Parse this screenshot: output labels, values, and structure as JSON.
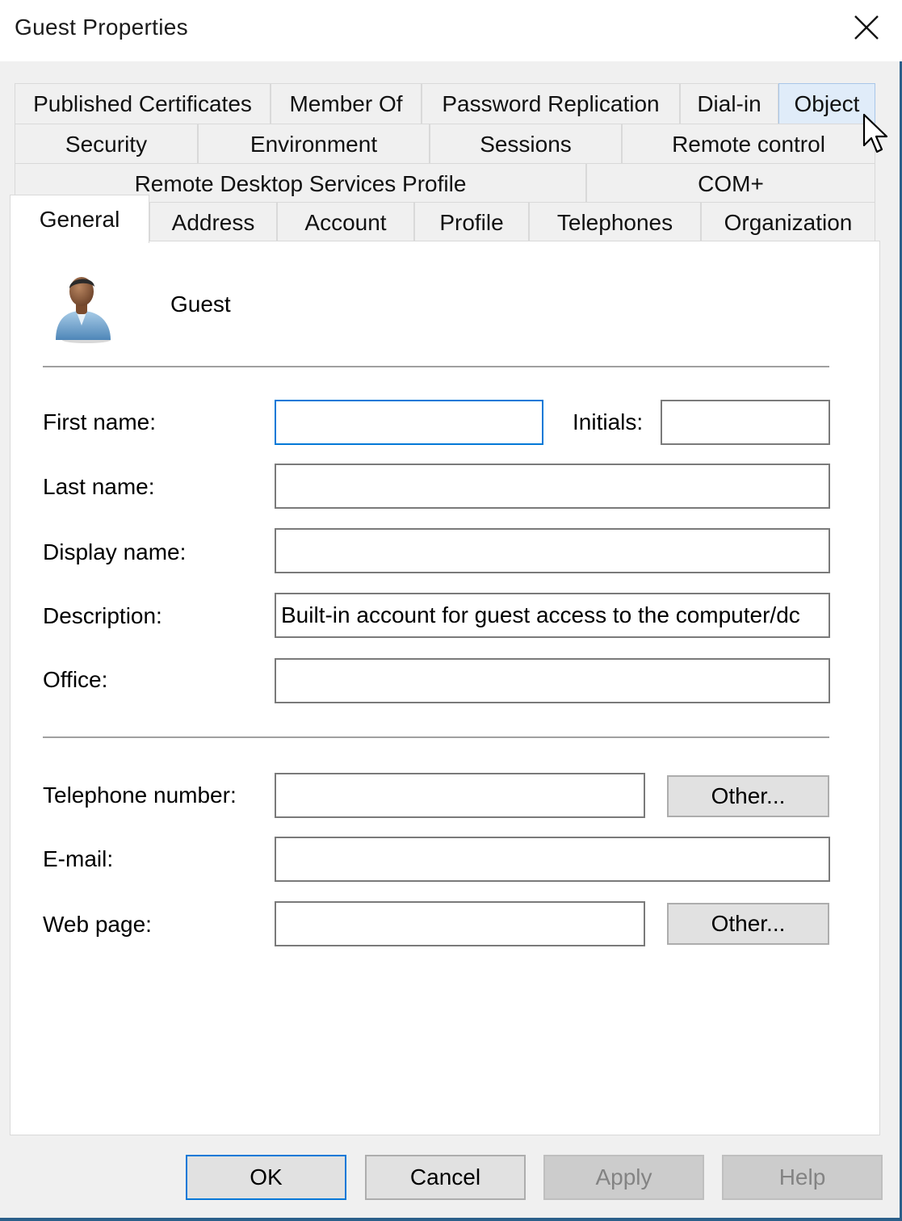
{
  "window": {
    "title": "Guest Properties",
    "close_icon": "close-icon"
  },
  "tabs": {
    "row1": [
      "Published Certificates",
      "Member Of",
      "Password Replication",
      "Dial-in",
      "Object"
    ],
    "row2": [
      "Security",
      "Environment",
      "Sessions",
      "Remote control"
    ],
    "row3": [
      "Remote Desktop Services Profile",
      "COM+"
    ],
    "row4": [
      "General",
      "Address",
      "Account",
      "Profile",
      "Telephones",
      "Organization"
    ],
    "active": "General",
    "hovered": "Object"
  },
  "general": {
    "user_icon": "user-icon",
    "user_name": "Guest",
    "first_name": {
      "label": "First name:",
      "value": ""
    },
    "initials": {
      "label": "Initials:",
      "value": ""
    },
    "last_name": {
      "label": "Last name:",
      "value": ""
    },
    "display_name": {
      "label": "Display name:",
      "value": ""
    },
    "description": {
      "label": "Description:",
      "value": "Built-in account for guest access to the computer/dc"
    },
    "office": {
      "label": "Office:",
      "value": ""
    },
    "telephone": {
      "label": "Telephone number:",
      "value": "",
      "other_label": "Other..."
    },
    "email": {
      "label": "E-mail:",
      "value": ""
    },
    "web_page": {
      "label": "Web page:",
      "value": "",
      "other_label": "Other..."
    }
  },
  "buttons": {
    "ok": "OK",
    "cancel": "Cancel",
    "apply": "Apply",
    "help": "Help"
  },
  "colors": {
    "focus_accent": "#0078d7",
    "tab_hover": "#e0ecf9",
    "panel_bg": "#ffffff",
    "window_bg": "#f0f0f0"
  }
}
